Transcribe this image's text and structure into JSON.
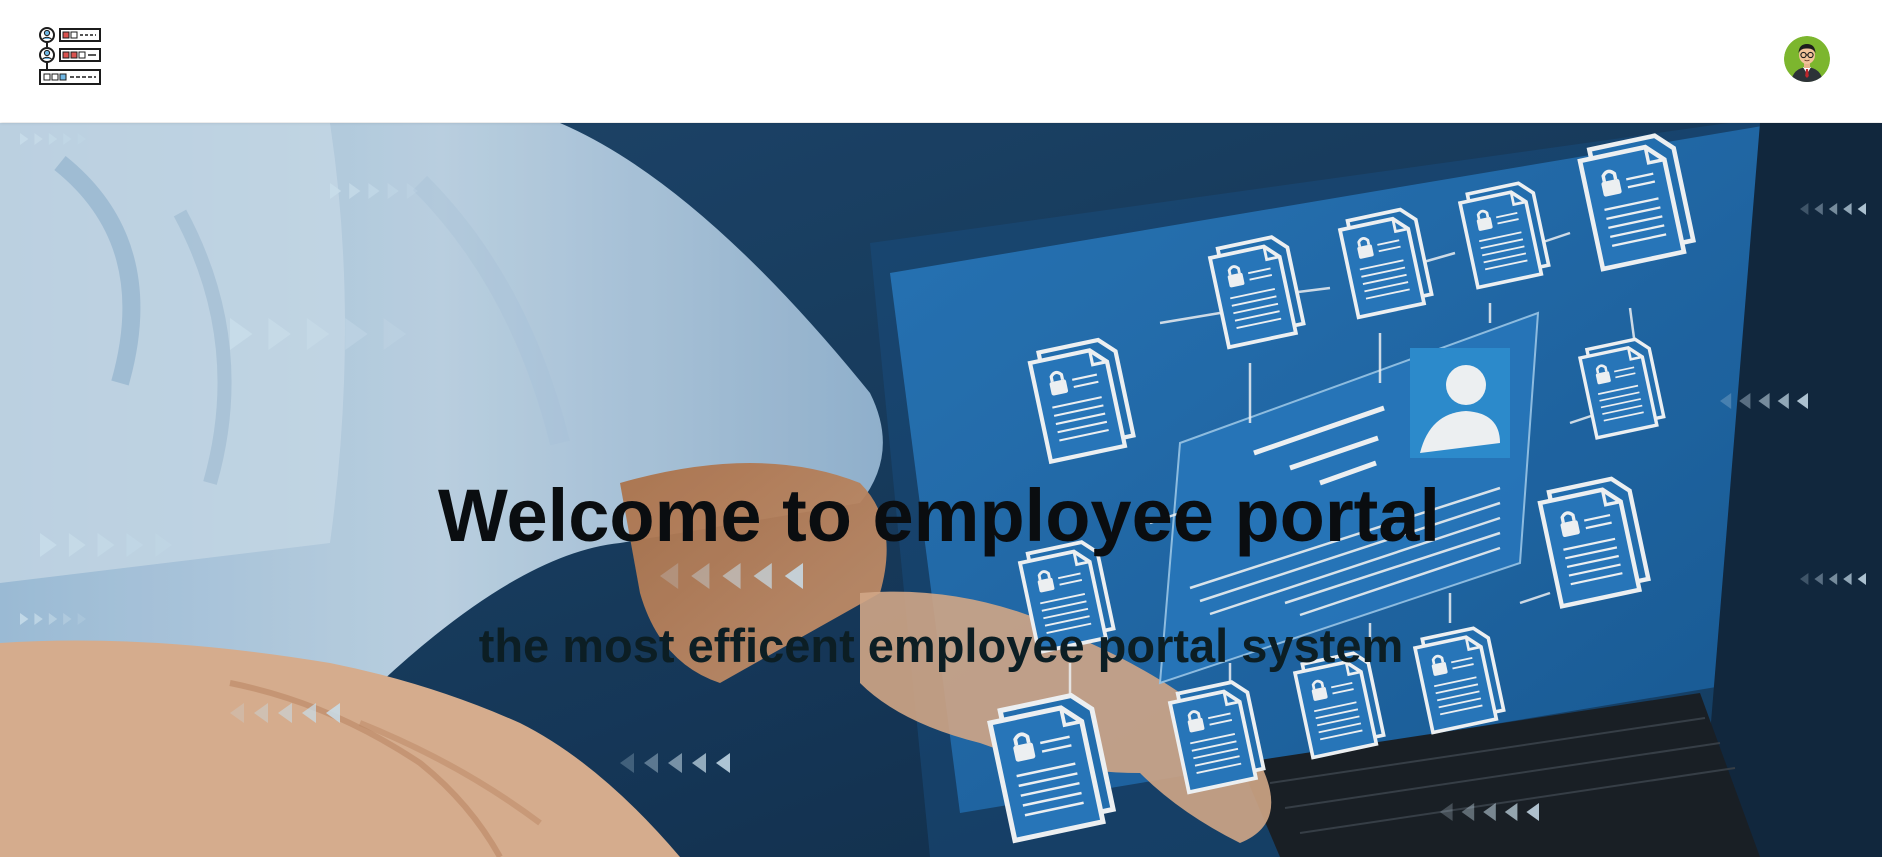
{
  "header": {
    "logo_icon": "org-chart-document-icon",
    "avatar_icon": "user-avatar-icon",
    "colors": {
      "avatar_bg": "#7cb62e",
      "header_bg": "#ffffff"
    }
  },
  "hero": {
    "title": "Welcome to employee portal",
    "subtitle": "the most efficent employee portal system",
    "background_icon": "laptop-documents-network-illustration",
    "colors": {
      "overlay_blue": "#1f5f99",
      "title_color": "#0a0d10",
      "subtitle_color": "#0c1e24"
    }
  }
}
